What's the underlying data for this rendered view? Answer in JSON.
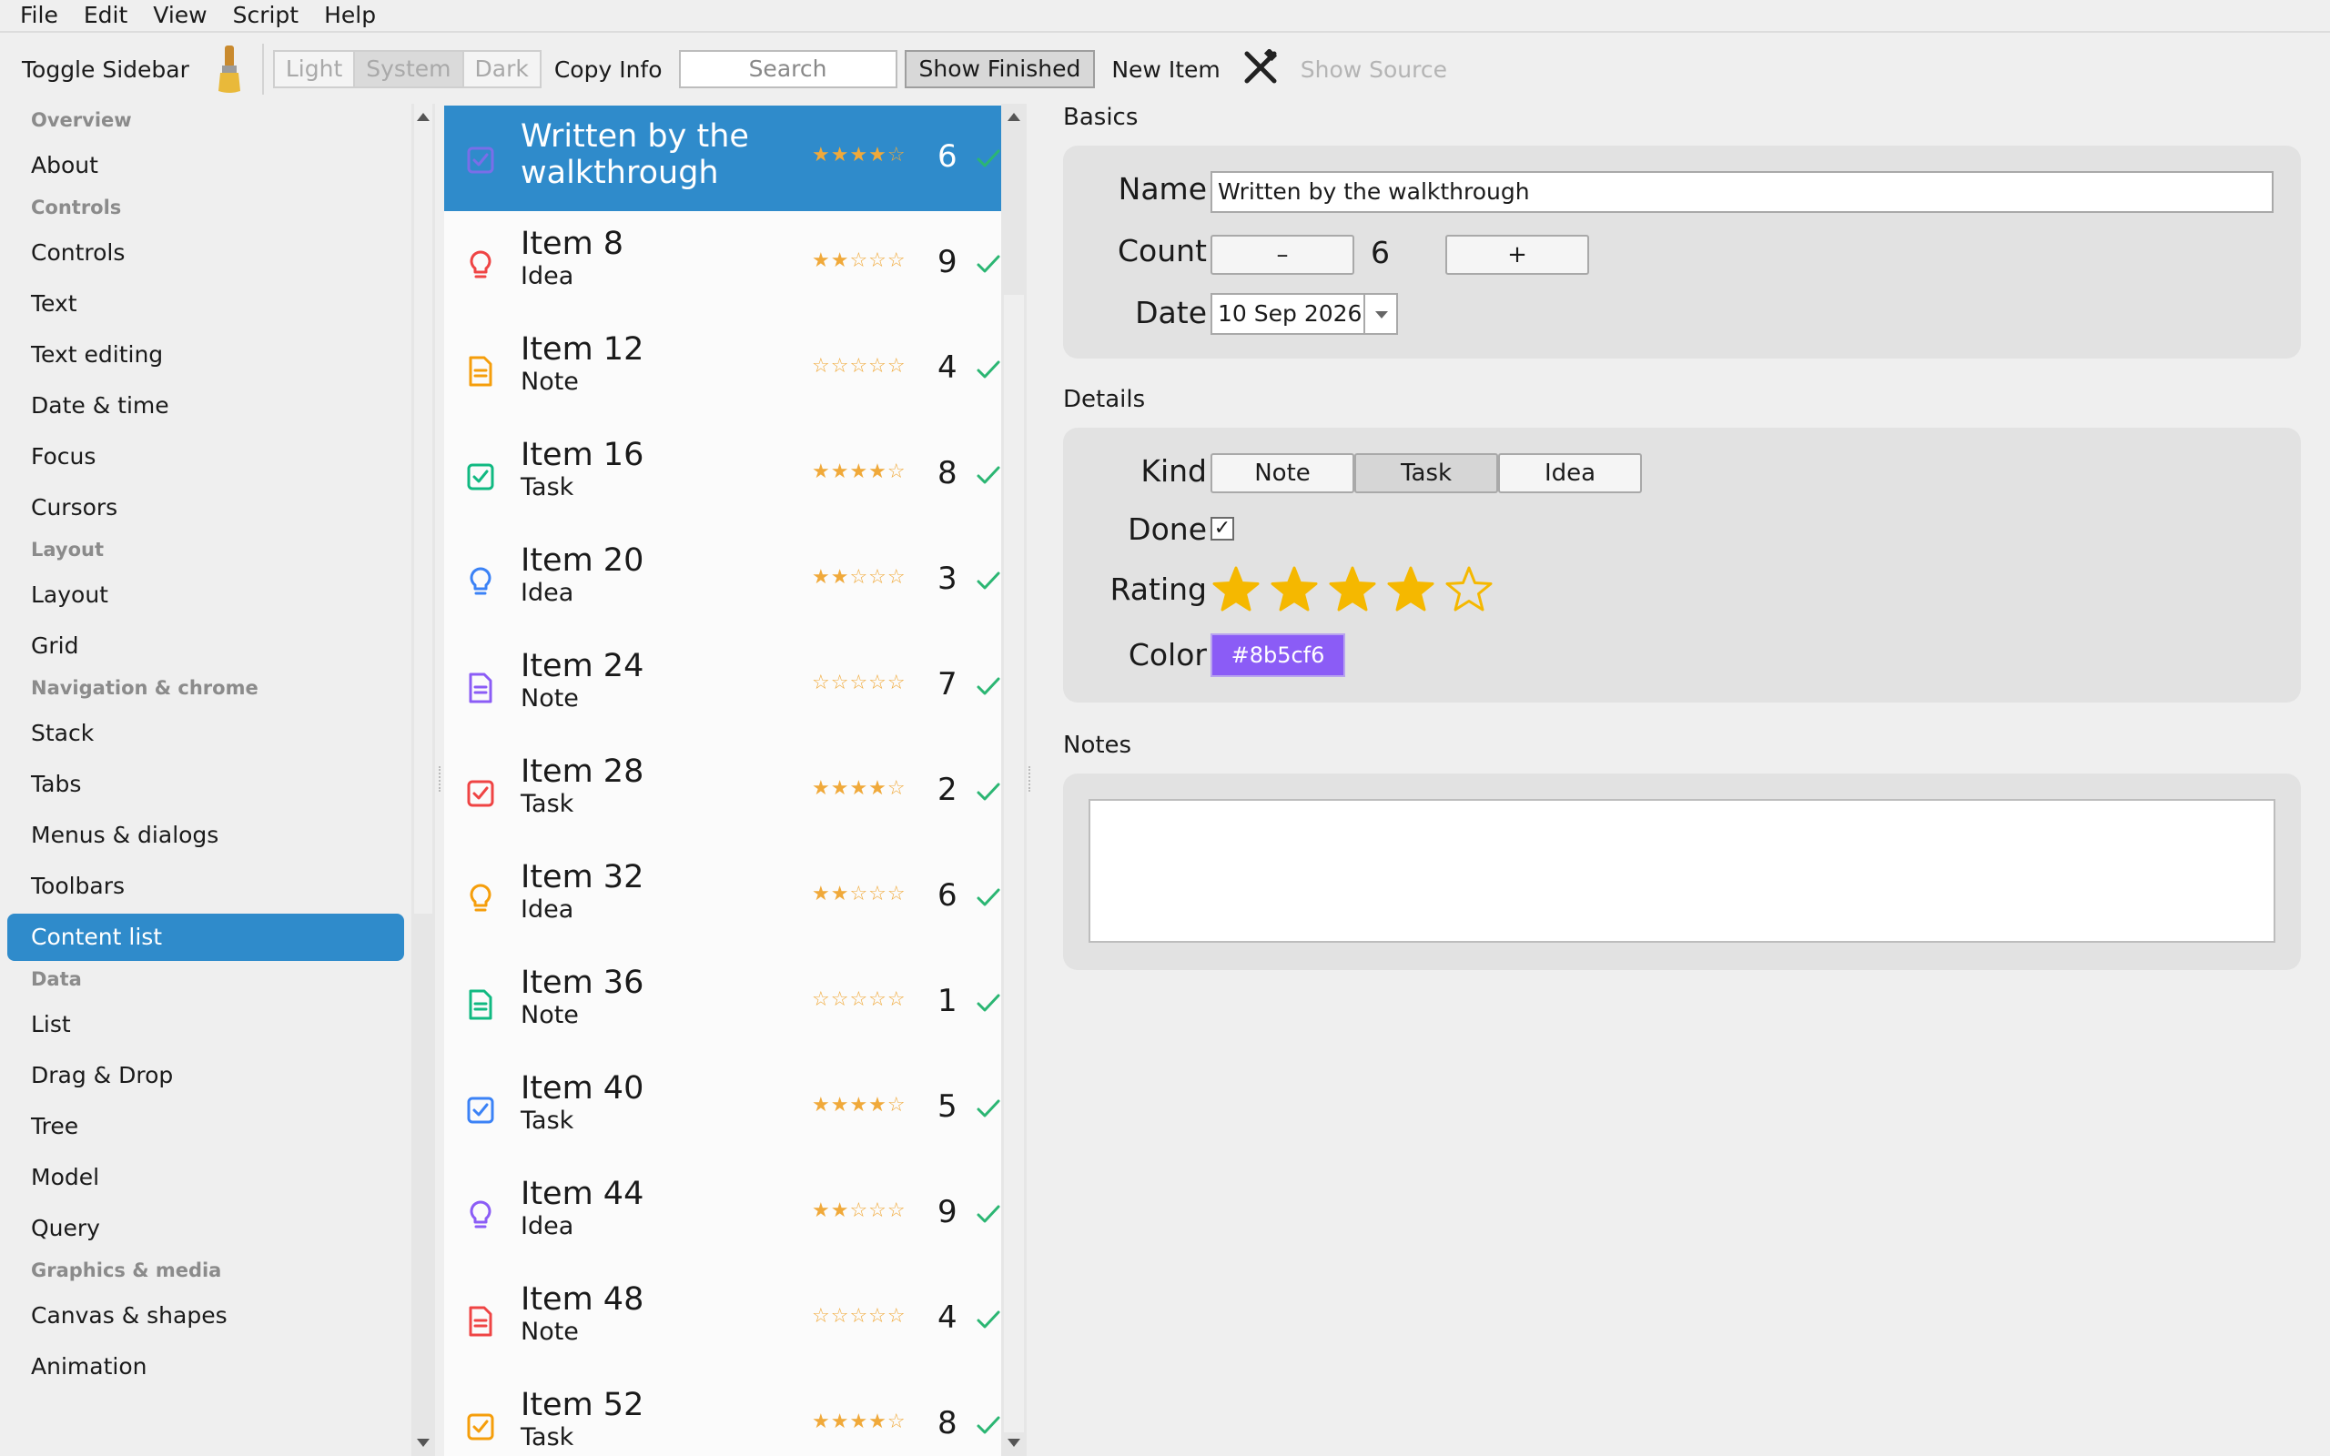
{
  "menu": [
    "File",
    "Edit",
    "View",
    "Script",
    "Help"
  ],
  "toolbar": {
    "toggle_sidebar": "Toggle Sidebar",
    "theme": [
      "Light",
      "System",
      "Dark"
    ],
    "copy_info": "Copy Info",
    "search_placeholder": "Search",
    "show_finished": "Show Finished",
    "new_item": "New Item",
    "show_source": "Show Source"
  },
  "sidebar": {
    "sections": [
      {
        "title": "Overview",
        "items": [
          "About"
        ]
      },
      {
        "title": "Controls",
        "items": [
          "Controls",
          "Text",
          "Text editing",
          "Date & time",
          "Focus",
          "Cursors"
        ]
      },
      {
        "title": "Layout",
        "items": [
          "Layout",
          "Grid"
        ]
      },
      {
        "title": "Navigation & chrome",
        "items": [
          "Stack",
          "Tabs",
          "Menus & dialogs",
          "Toolbars",
          "Content list"
        ]
      },
      {
        "title": "Data",
        "items": [
          "List",
          "Drag & Drop",
          "Tree",
          "Model",
          "Query"
        ]
      },
      {
        "title": "Graphics & media",
        "items": [
          "Canvas & shapes",
          "Animation"
        ]
      }
    ],
    "active": "Content list"
  },
  "list": {
    "rows": [
      {
        "title": "Written by the walkthrough",
        "title_lines": [
          "Written by the",
          "walkthrough"
        ],
        "kind": "Task",
        "color": "#8b5cf6",
        "rating": 4,
        "count": "6",
        "selected": true
      },
      {
        "title": "Item 8",
        "kind": "Idea",
        "color": "#ef4444",
        "rating": 2,
        "count": "9"
      },
      {
        "title": "Item 12",
        "kind": "Note",
        "color": "#f59e0b",
        "rating": 0,
        "count": "4"
      },
      {
        "title": "Item 16",
        "kind": "Task",
        "color": "#10b981",
        "rating": 4,
        "count": "8"
      },
      {
        "title": "Item 20",
        "kind": "Idea",
        "color": "#3b82f6",
        "rating": 2,
        "count": "3"
      },
      {
        "title": "Item 24",
        "kind": "Note",
        "color": "#8b5cf6",
        "rating": 0,
        "count": "7"
      },
      {
        "title": "Item 28",
        "kind": "Task",
        "color": "#ef4444",
        "rating": 4,
        "count": "2"
      },
      {
        "title": "Item 32",
        "kind": "Idea",
        "color": "#f59e0b",
        "rating": 2,
        "count": "6"
      },
      {
        "title": "Item 36",
        "kind": "Note",
        "color": "#10b981",
        "rating": 0,
        "count": "1"
      },
      {
        "title": "Item 40",
        "kind": "Task",
        "color": "#3b82f6",
        "rating": 4,
        "count": "5"
      },
      {
        "title": "Item 44",
        "kind": "Idea",
        "color": "#8b5cf6",
        "rating": 2,
        "count": "9"
      },
      {
        "title": "Item 48",
        "kind": "Note",
        "color": "#ef4444",
        "rating": 0,
        "count": "4"
      },
      {
        "title": "Item 52",
        "kind": "Task",
        "color": "#f59e0b",
        "rating": 4,
        "count": "8"
      }
    ]
  },
  "detail": {
    "basics_title": "Basics",
    "name_label": "Name",
    "name_value": "Written by the walkthrough",
    "count_label": "Count",
    "count_value": "6",
    "minus": "–",
    "plus": "+",
    "date_label": "Date",
    "date_value": "10 Sep 2026",
    "details_title": "Details",
    "kind_label": "Kind",
    "kinds": [
      "Note",
      "Task",
      "Idea"
    ],
    "kind_selected": "Task",
    "done_label": "Done",
    "done_mark": "✓",
    "rating_label": "Rating",
    "rating_value": 4,
    "rating_max": 5,
    "color_label": "Color",
    "color_value": "#8b5cf6",
    "color_text": "#8b5cf6",
    "notes_title": "Notes",
    "notes_value": ""
  }
}
